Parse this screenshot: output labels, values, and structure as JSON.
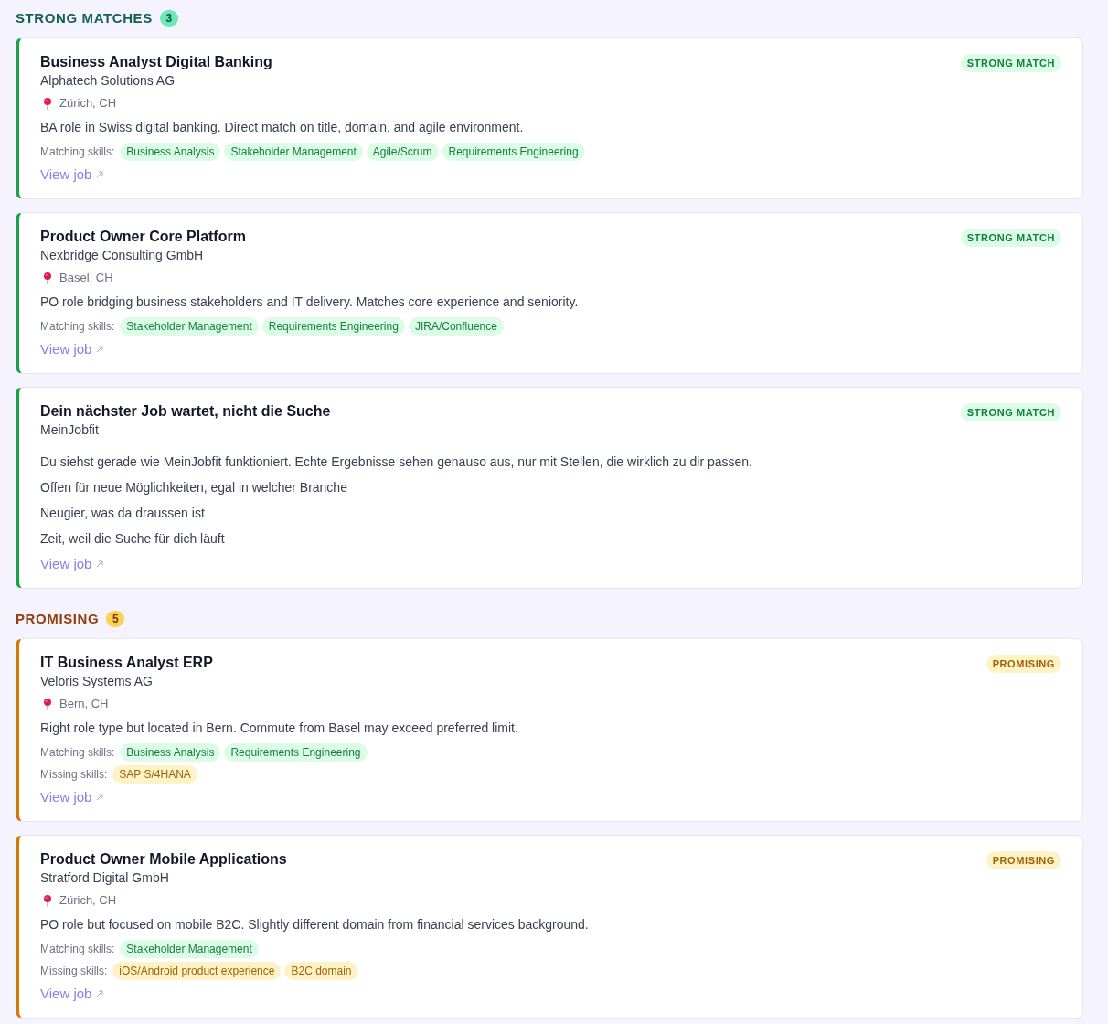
{
  "sections": [
    {
      "kind": "strong",
      "title": "STRONG MATCHES",
      "count": "3",
      "jobs": [
        {
          "title": "Business Analyst Digital Banking",
          "company": "Alphatech Solutions AG",
          "badge": "STRONG MATCH",
          "location": "Zürich, CH",
          "description": [
            "BA role in Swiss digital banking. Direct match on title, domain, and agile environment."
          ],
          "skill_groups": [
            {
              "kind": "matching",
              "label": "Matching skills:",
              "skills": [
                "Business Analysis",
                "Stakeholder Management",
                "Agile/Scrum",
                "Requirements Engineering"
              ]
            }
          ],
          "link": "View job"
        },
        {
          "title": "Product Owner Core Platform",
          "company": "Nexbridge Consulting GmbH",
          "badge": "STRONG MATCH",
          "location": "Basel, CH",
          "description": [
            "PO role bridging business stakeholders and IT delivery. Matches core experience and seniority."
          ],
          "skill_groups": [
            {
              "kind": "matching",
              "label": "Matching skills:",
              "skills": [
                "Stakeholder Management",
                "Requirements Engineering",
                "JIRA/Confluence"
              ]
            }
          ],
          "link": "View job"
        },
        {
          "title": "Dein nächster Job wartet, nicht die Suche",
          "company": "MeinJobfit",
          "badge": "STRONG MATCH",
          "description": [
            "Du siehst gerade wie MeinJobfit funktioniert. Echte Ergebnisse sehen genauso aus, nur mit Stellen, die wirklich zu dir passen.",
            "Offen für neue Möglichkeiten, egal in welcher Branche",
            "Neugier, was da draussen ist",
            "Zeit, weil die Suche für dich läuft"
          ],
          "link": "View job"
        }
      ]
    },
    {
      "kind": "promising",
      "title": "PROMISING",
      "count": "5",
      "jobs": [
        {
          "title": "IT Business Analyst ERP",
          "company": "Veloris Systems AG",
          "badge": "PROMISING",
          "location": "Bern, CH",
          "description": [
            "Right role type but located in Bern. Commute from Basel may exceed preferred limit."
          ],
          "skill_groups": [
            {
              "kind": "matching",
              "label": "Matching skills:",
              "skills": [
                "Business Analysis",
                "Requirements Engineering"
              ]
            },
            {
              "kind": "missing",
              "label": "Missing skills:",
              "skills": [
                "SAP S/4HANA"
              ]
            }
          ],
          "link": "View job"
        },
        {
          "title": "Product Owner Mobile Applications",
          "company": "Stratford Digital GmbH",
          "badge": "PROMISING",
          "location": "Zürich, CH",
          "description": [
            "PO role but focused on mobile B2C. Slightly different domain from financial services background."
          ],
          "skill_groups": [
            {
              "kind": "matching",
              "label": "Matching skills:",
              "skills": [
                "Stakeholder Management"
              ]
            },
            {
              "kind": "missing",
              "label": "Missing skills:",
              "skills": [
                "iOS/Android product experience",
                "B2C domain"
              ]
            }
          ],
          "link": "View job"
        }
      ]
    }
  ]
}
